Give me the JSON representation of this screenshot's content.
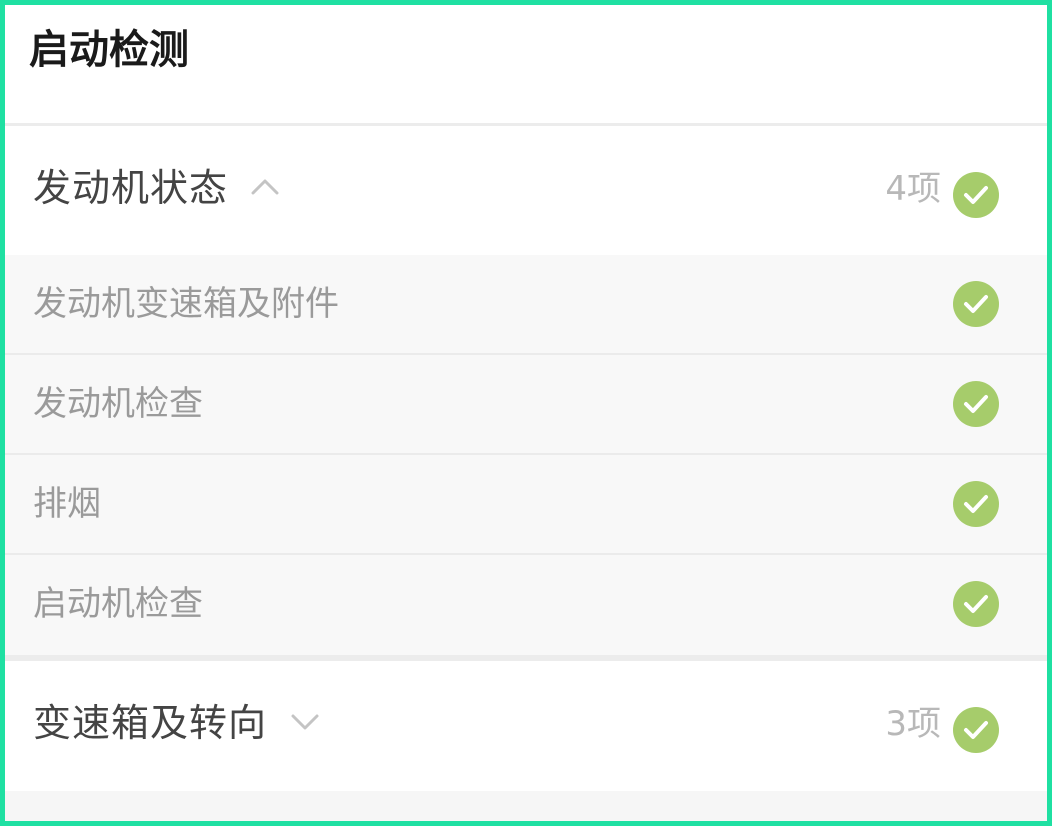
{
  "page": {
    "title": "启动检测"
  },
  "sections": [
    {
      "title": "发动机状态",
      "count": "4项",
      "expanded": true,
      "status_icon": "check-circle-icon",
      "items": [
        {
          "label": "发动机变速箱及附件",
          "status_icon": "check-circle-icon"
        },
        {
          "label": "发动机检查",
          "status_icon": "check-circle-icon"
        },
        {
          "label": "排烟",
          "status_icon": "check-circle-icon"
        },
        {
          "label": "启动机检查",
          "status_icon": "check-circle-icon"
        }
      ]
    },
    {
      "title": "变速箱及转向",
      "count": "3项",
      "expanded": false,
      "status_icon": "check-circle-icon"
    }
  ],
  "colors": {
    "frame_border": "#1fe0a2",
    "check_fill": "#a6cc6b",
    "sub_bg": "#f8f8f8"
  }
}
